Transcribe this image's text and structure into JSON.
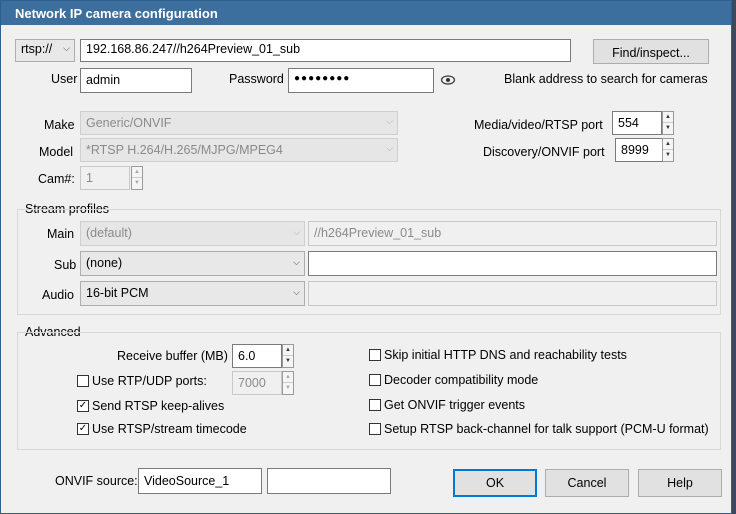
{
  "window": {
    "title": "Network IP camera configuration"
  },
  "address": {
    "protocol": "rtsp://",
    "value": "192.168.86.247//h264Preview_01_sub",
    "find_button": "Find/inspect...",
    "hint": "Blank address to search for cameras"
  },
  "credentials": {
    "user_label": "User",
    "user_value": "admin",
    "password_label": "Password",
    "password_value": "●●●●●●●●"
  },
  "device": {
    "make_label": "Make",
    "make_value": "Generic/ONVIF",
    "model_label": "Model",
    "model_value": "*RTSP H.264/H.265/MJPG/MPEG4",
    "cam_label": "Cam#:",
    "cam_value": "1"
  },
  "ports": {
    "media_label": "Media/video/RTSP port",
    "media_value": "554",
    "discovery_label": "Discovery/ONVIF port",
    "discovery_value": "8999"
  },
  "stream_profiles": {
    "title": "Stream profiles",
    "main_label": "Main",
    "main_value": "(default)",
    "main_path": "//h264Preview_01_sub",
    "sub_label": "Sub",
    "sub_value": "(none)",
    "sub_path": "",
    "audio_label": "Audio",
    "audio_value": "16-bit PCM",
    "audio_path": ""
  },
  "advanced": {
    "title": "Advanced",
    "receive_buffer_label": "Receive buffer (MB)",
    "receive_buffer_value": "6.0",
    "rtp_label": "Use RTP/UDP ports:",
    "rtp_checked": false,
    "rtp_value": "7000",
    "keepalive_label": "Send RTSP keep-alives",
    "keepalive_checked": true,
    "timecode_label": "Use RTSP/stream timecode",
    "timecode_checked": true,
    "skip_dns_label": "Skip initial HTTP DNS and reachability tests",
    "skip_dns_checked": false,
    "decoder_label": "Decoder compatibility mode",
    "decoder_checked": false,
    "onvif_events_label": "Get ONVIF trigger events",
    "onvif_events_checked": false,
    "backchannel_label": "Setup RTSP back-channel for talk support (PCM-U format)",
    "backchannel_checked": false
  },
  "footer": {
    "onvif_source_label": "ONVIF source:",
    "onvif_source_value": "VideoSource_1",
    "onvif_source_extra": "",
    "ok": "OK",
    "cancel": "Cancel",
    "help": "Help"
  },
  "check_mark": "✓",
  "spin_up": "▲",
  "spin_down": "▼",
  "dropdown_arrow": "⌵"
}
